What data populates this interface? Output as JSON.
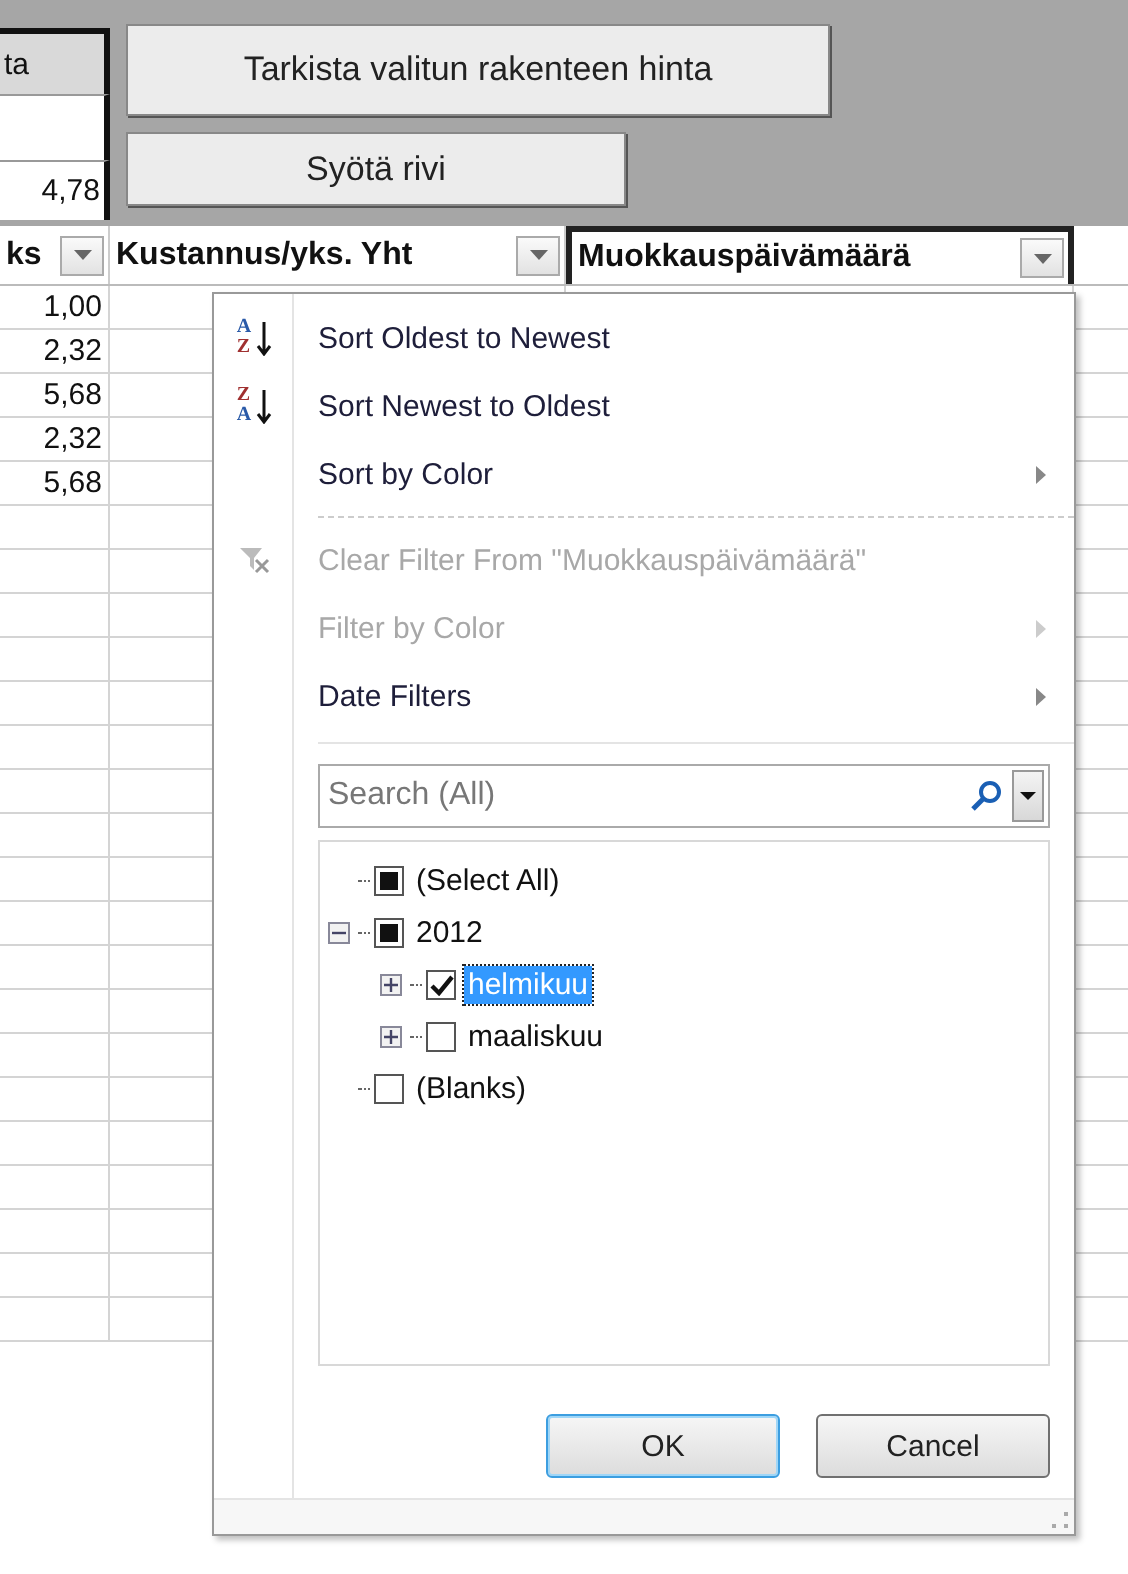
{
  "sheet": {
    "left_header": "ta",
    "left_total": "4,78",
    "buttons": [
      {
        "label": "Tarkista valitun rakenteen hinta"
      },
      {
        "label": "Syötä rivi"
      }
    ],
    "headers": [
      {
        "label": "ks",
        "selected": false
      },
      {
        "label": "Kustannus/yks. Yht",
        "selected": false
      },
      {
        "label": "Muokkauspäivämäärä",
        "selected": true
      }
    ],
    "rows": [
      "1,00",
      "2,32",
      "5,68",
      "2,32",
      "5,68"
    ]
  },
  "filter_menu": {
    "items": [
      {
        "kind": "sort-asc",
        "icon_letters": [
          "A",
          "Z"
        ],
        "label": "Sort Oldest to Newest",
        "disabled": false,
        "submenu": false
      },
      {
        "kind": "sort-desc",
        "icon_letters": [
          "Z",
          "A"
        ],
        "label": "Sort Newest to Oldest",
        "disabled": false,
        "submenu": false
      },
      {
        "kind": "plain",
        "label": "Sort by Color",
        "disabled": false,
        "submenu": true
      },
      {
        "kind": "separator"
      },
      {
        "kind": "clear-filter",
        "label": "Clear Filter From \"Muokkauspäivämäärä\"",
        "disabled": true,
        "submenu": false
      },
      {
        "kind": "plain",
        "label": "Filter by Color",
        "disabled": true,
        "submenu": true
      },
      {
        "kind": "plain",
        "label": "Date Filters",
        "disabled": false,
        "submenu": true
      }
    ],
    "search": {
      "placeholder": "Search (All)"
    },
    "tree": [
      {
        "label": "(Select All)",
        "checked": false,
        "partial": true,
        "selected": false
      },
      {
        "label": "2012",
        "checked": false,
        "partial": true,
        "selected": false,
        "expanded": true,
        "children": [
          {
            "label": "helmikuu",
            "checked": true,
            "partial": false,
            "selected": true,
            "expanded": false
          },
          {
            "label": "maaliskuu",
            "checked": false,
            "partial": false,
            "selected": false,
            "expanded": false
          }
        ]
      },
      {
        "label": "(Blanks)",
        "checked": false,
        "partial": false,
        "selected": false
      }
    ],
    "buttons": [
      {
        "label": "OK",
        "default": true
      },
      {
        "label": "Cancel",
        "default": false
      }
    ]
  }
}
